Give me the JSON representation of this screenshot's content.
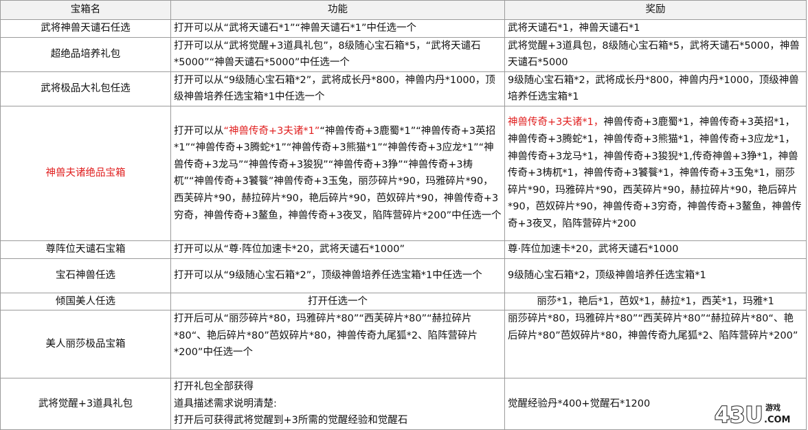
{
  "header": {
    "col1": "宝箱名",
    "col2": "功能",
    "col3": "奖励"
  },
  "rows": [
    {
      "name": "武将神兽天谴石任选",
      "func": "打开可以从“武将天谴石*1”“神兽天谴石*1”中任选一个",
      "reward": "武将天谴石*1，神兽天谴石*1"
    },
    {
      "name": "超绝品培养礼包",
      "func": "打开可以从“武将觉醒+3道具礼包”，8级随心宝石箱*5，“武将天谴石*5000”“神兽天谴石*5000”中任选一个",
      "reward": "武将觉醒+3道具包，8级随心宝石箱*5，武将天谴石*5000，神兽天谴石*5000"
    },
    {
      "name": "武将极品大礼包任选",
      "func": "打开可以从“9级随心宝石箱*2”，武将成长丹*800，神兽内丹*1000，顶级神兽培养任选宝箱*1中任选一个",
      "reward": "9级随心宝石箱*2，武将成长丹*800，神兽内丹*1000，顶级神兽培养任选宝箱*1"
    },
    {
      "name": "神兽夫诸绝品宝箱",
      "func_pre": "打开可以从",
      "func_red": "“神兽传奇+3夫诸*1”",
      "func_post": "“神兽传奇+3鹿蜀*1”“神兽传奇+3英招*1”“神兽传奇+3腾蛇*1”“神兽传奇+3熊猫*1”“神兽传奇+3应龙*1”“神兽传奇+3龙马”“神兽传奇+3狻猊”“神兽传奇+3狰”“神兽传奇+3梼杌”“神兽传奇+3饕餮”神兽传奇+3玉兔，丽莎碎片*90，玛雅碎片*90，西芙碎片*90，赫拉碎片*90，艳后碎片*90，芭奴碎片*90，神兽传奇+3穷奇，神兽传奇+3鳌鱼，神兽传奇+3夜叉，陷阵营碎片*200”中任选一个",
      "reward_red": "神兽传奇+3夫诸*1，",
      "reward_post": "神兽传奇+3鹿蜀*1，神兽传奇+3英招*1，神兽传奇+3腾蛇*1，神兽传奇+3熊猫*1，神兽传奇+3应龙*1，神兽传奇+3龙马*1，神兽传奇+3狻猊*1,传奇神兽+3狰*1，神兽传奇+3梼杌*1，神兽传奇+3饕餮*1，神兽传奇+3玉兔*1，丽莎碎片*90，玛雅碎片*90，西芙碎片*90，赫拉碎片*90，艳后碎片*90，芭奴碎片*90，神兽传奇+3穷奇，神兽传奇+3鳌鱼，神兽传奇+3夜叉，陷阵营碎片*200"
    },
    {
      "name": "尊阵位天谴石宝箱",
      "func": "打开可以从“尊·阵位加速卡*20，武将天谴石*1000”",
      "reward": "尊·阵位加速卡*20，武将天谴石*1000"
    },
    {
      "name": "宝石神兽任选",
      "func": "打开可以从“9级随心宝石箱*2”，顶级神兽培养任选宝箱*1中任选一个",
      "reward": "9级随心宝石箱*2，顶级神兽培养任选宝箱*1"
    },
    {
      "name": "倾国美人任选",
      "func": "打开任选一个",
      "reward": "丽莎*1，艳后*1，芭奴*1，赫拉*1，西芙*1，玛雅*1"
    },
    {
      "name": "美人丽莎极品宝箱",
      "func": "打开后可从“丽莎碎片*80，玛雅碎片*80”“西芙碎片*80”“赫拉碎片*80“、艳后碎片*80”芭奴碎片*80，神兽传奇九尾狐*2、陷阵营碎片*200”中任选一个",
      "reward": "丽莎碎片*80，玛雅碎片*80”“西芙碎片*80”“赫拉碎片*80“、艳后碎片*80”芭奴碎片*80，神兽传奇九尾狐*2、陷阵营碎片*200”"
    },
    {
      "name": "武将觉醒+3道具礼包",
      "func_lines": [
        "打开礼包全部获得",
        "道具描述需求说明清楚:",
        "打开后可获得武将觉醒到+3所需的觉醒经验和觉醒石"
      ],
      "reward": "觉醒经验丹*400+觉醒石*1200"
    }
  ],
  "watermark": {
    "text": "43U",
    "sub": "游戏",
    "domain": ".COM"
  },
  "colors": {
    "red": "#e02020",
    "header_bg": "#f2f2f2",
    "border": "#9a9a9a"
  }
}
